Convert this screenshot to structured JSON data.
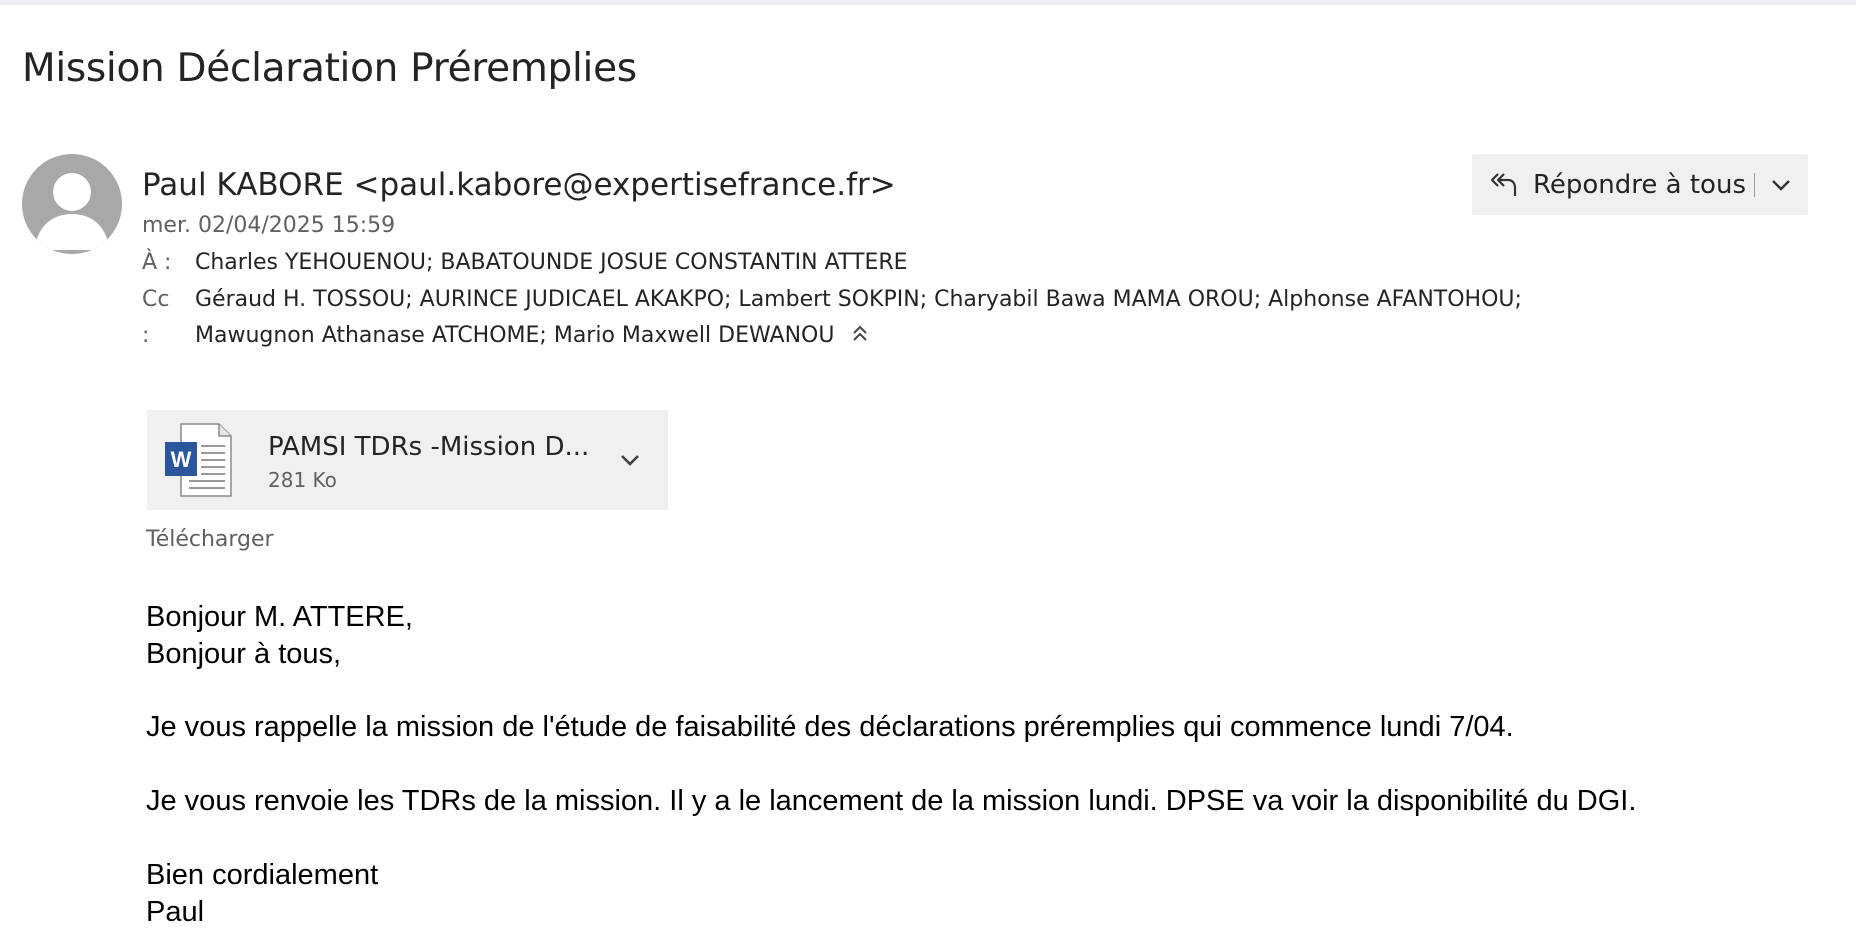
{
  "email": {
    "subject": "Mission Déclaration Préremplies",
    "sender": "Paul KABORE <paul.kabore@expertisefrance.fr>",
    "date": "mer. 02/04/2025 15:59",
    "to_label": "À :",
    "to": "Charles YEHOUENOU; BABATOUNDE JOSUE CONSTANTIN ATTERE",
    "cc_label": "Cc",
    "cc_label_cont": ":",
    "cc_line1": "Géraud H. TOSSOU; AURINCE JUDICAEL AKAKPO; Lambert SOKPIN; Charyabil Bawa MAMA OROU; Alphonse AFANTOHOU;",
    "cc_line2": "Mawugnon Athanase ATCHOME; Mario Maxwell DEWANOU"
  },
  "actions": {
    "reply_all_label": "Répondre à tous"
  },
  "attachment": {
    "name": "PAMSI TDRs -Mission D...",
    "size": "281 Ko",
    "download_label": "Télécharger"
  },
  "body": {
    "lines": [
      "Bonjour M. ATTERE,",
      "Bonjour à tous,",
      "Je vous rappelle la mission de l'étude de faisabilité des déclarations préremplies qui commence lundi 7/04.",
      "Je vous renvoie les TDRs de la mission. Il y a le lancement de la mission lundi. DPSE va voir la disponibilité du DGI.",
      "Bien cordialement",
      "Paul"
    ]
  },
  "colors": {
    "avatar": "#a8a8a8",
    "button_bg": "#f0f0f0",
    "word_blue": "#2b579a",
    "muted_text": "#616161"
  }
}
